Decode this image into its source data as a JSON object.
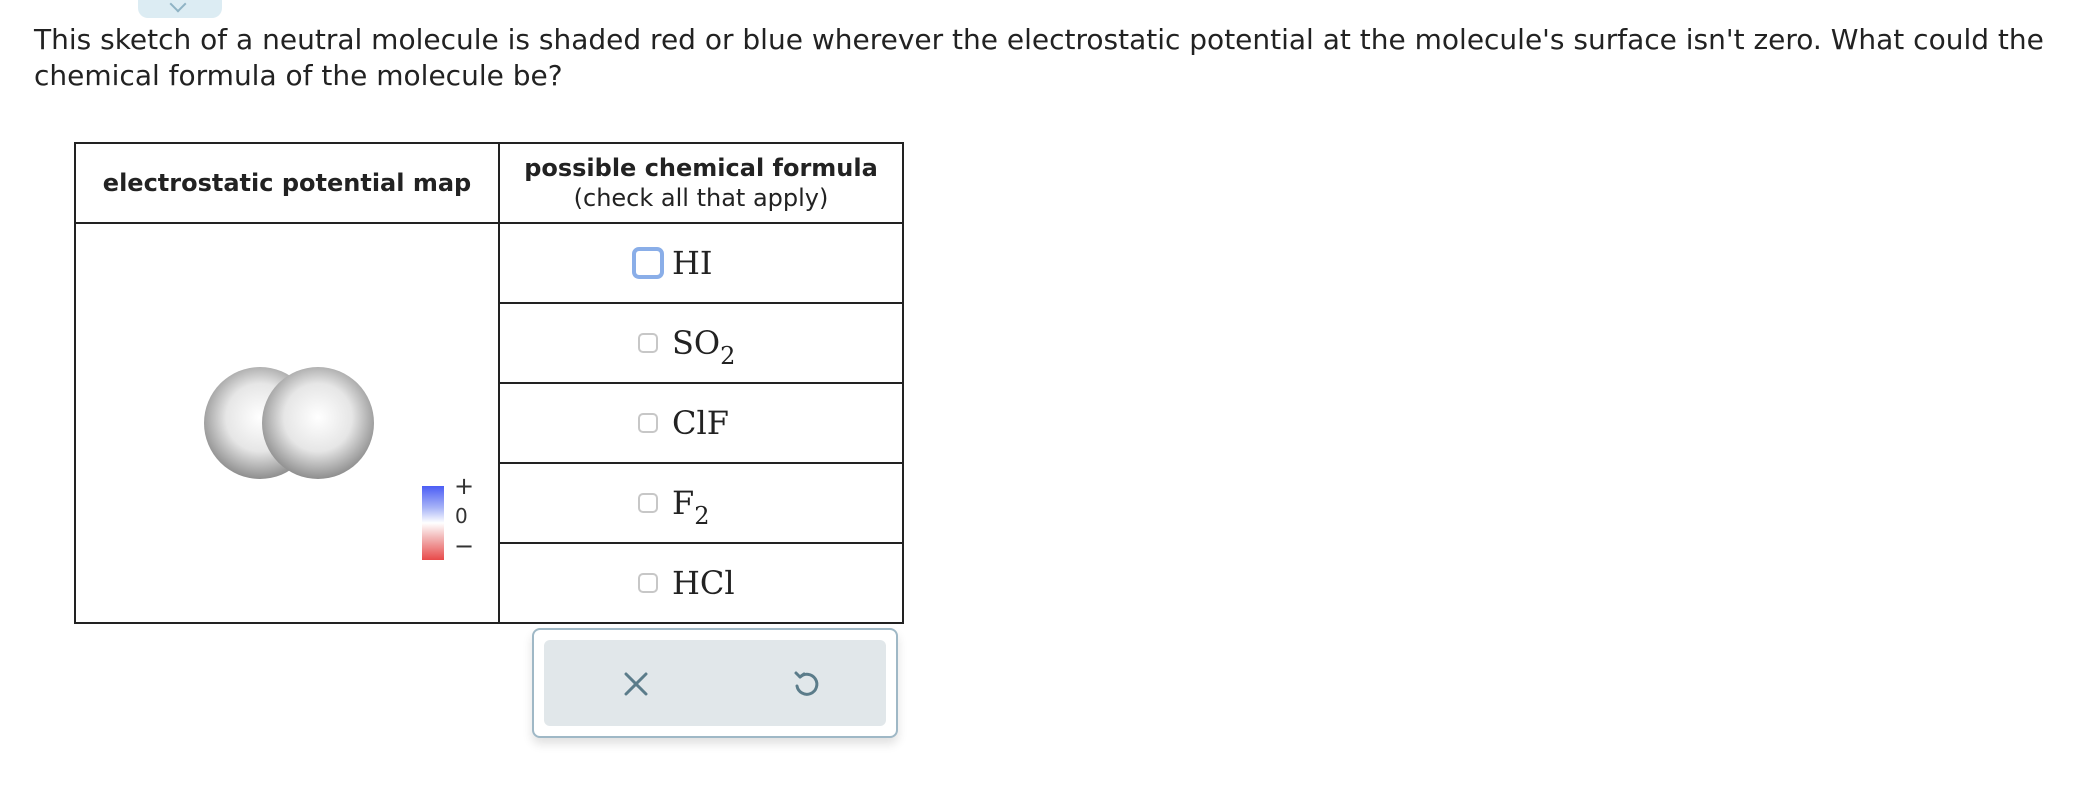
{
  "question": {
    "text": "This sketch of a neutral molecule is shaded red or blue wherever the electrostatic potential at the molecule's surface isn't zero. What could the chemical formula of the molecule be?"
  },
  "table": {
    "header_map": "electrostatic potential map",
    "header_formula_title": "possible chemical formula",
    "header_formula_hint": "(check all that apply)"
  },
  "legend": {
    "plus": "+",
    "zero": "0",
    "minus": "−",
    "colors": {
      "positive": "#4b5df5",
      "neutral": "#ffffff",
      "negative": "#e84a4a"
    }
  },
  "molecule": {
    "shading": "neutral-gray"
  },
  "options": [
    {
      "main": "HI",
      "sub": "",
      "checked": false,
      "focused": true
    },
    {
      "main": "SO",
      "sub": "2",
      "checked": false,
      "focused": false
    },
    {
      "main": "ClF",
      "sub": "",
      "checked": false,
      "focused": false
    },
    {
      "main": "F",
      "sub": "2",
      "checked": false,
      "focused": false
    },
    {
      "main": "HCl",
      "sub": "",
      "checked": false,
      "focused": false
    }
  ],
  "controls": {
    "clear_icon": "close-icon",
    "undo_icon": "undo-icon",
    "accent": "#5b7c8a"
  }
}
